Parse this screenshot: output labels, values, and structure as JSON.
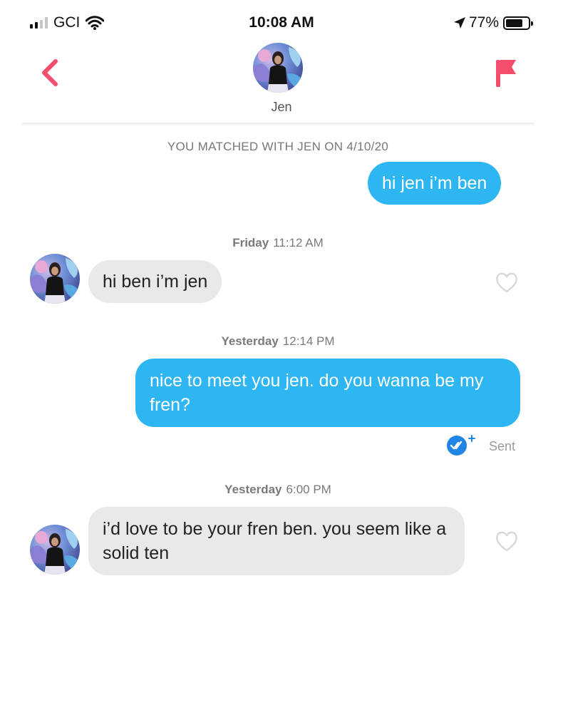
{
  "status_bar": {
    "carrier": "GCI",
    "time": "10:08 AM",
    "battery_percent": "77%",
    "battery_level": 0.77,
    "signal_bars_filled": 2,
    "signal_bars_total": 4
  },
  "header": {
    "contact_name": "Jen",
    "back_icon": "chevron-left-icon",
    "report_icon": "flag-icon"
  },
  "match_note": "YOU MATCHED WITH JEN ON 4/10/20",
  "messages": [
    {
      "direction": "outgoing",
      "text": "hi jen i’m ben"
    },
    {
      "timestamp_day": "Friday",
      "timestamp_time": "11:12 AM"
    },
    {
      "direction": "incoming",
      "text": "hi ben i’m jen"
    },
    {
      "timestamp_day": "Yesterday",
      "timestamp_time": "12:14 PM"
    },
    {
      "direction": "outgoing",
      "text": "nice to meet you jen. do you wanna be my fren?",
      "status": "Sent"
    },
    {
      "timestamp_day": "Yesterday",
      "timestamp_time": "6:00 PM"
    },
    {
      "direction": "incoming",
      "text": "i’d love to be your fren ben. you seem like a solid ten"
    }
  ],
  "colors": {
    "accent": "#f24e6b",
    "outgoing_bubble": "#2eb6f3",
    "incoming_bubble": "#e9e9ea",
    "sent_badge": "#1f86e6"
  }
}
